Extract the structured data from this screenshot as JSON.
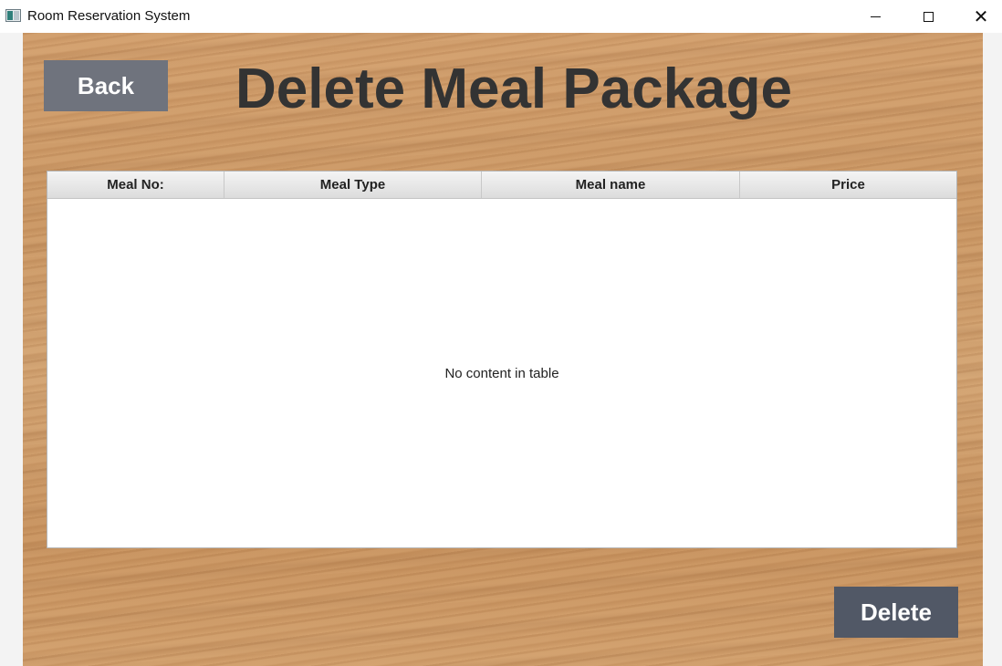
{
  "window": {
    "title": "Room Reservation System",
    "icon": "app-window-icon",
    "controls": {
      "minimize": "minimize-icon",
      "maximize": "maximize-icon",
      "close": "close-icon",
      "close_glyph": "✕"
    }
  },
  "header": {
    "back_label": "Back",
    "title": "Delete Meal Package"
  },
  "table": {
    "columns": [
      "Meal No:",
      "Meal Type",
      "Meal name",
      "Price"
    ],
    "rows": [],
    "empty_message": "No content in table"
  },
  "footer": {
    "delete_label": "Delete"
  },
  "colors": {
    "button_back": "#6f737d",
    "button_delete": "#515866",
    "title_text": "#333333",
    "wood_background": "#cc9966"
  }
}
